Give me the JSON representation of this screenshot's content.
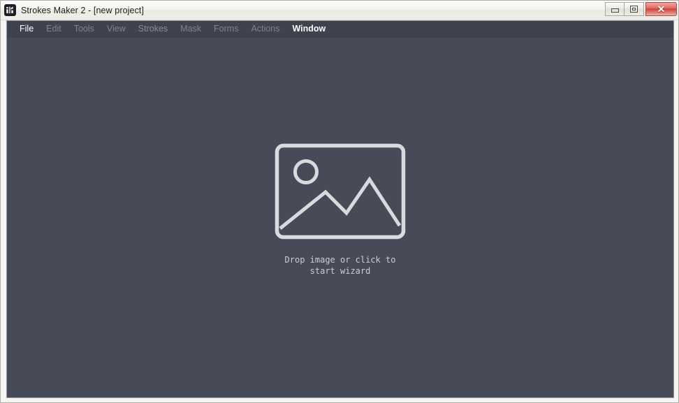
{
  "window": {
    "title": "Strokes Maker 2 - [new project]",
    "icon": "app-logo-icon",
    "controls": {
      "minimize_label": "–",
      "maximize_label": "□",
      "close_label": "✕"
    }
  },
  "menu": {
    "items": [
      {
        "label": "File",
        "state": "active"
      },
      {
        "label": "Edit",
        "state": "dim"
      },
      {
        "label": "Tools",
        "state": "dim"
      },
      {
        "label": "View",
        "state": "dim"
      },
      {
        "label": "Strokes",
        "state": "semi"
      },
      {
        "label": "Mask",
        "state": "dim"
      },
      {
        "label": "Forms",
        "state": "dim"
      },
      {
        "label": "Actions",
        "state": "dim"
      },
      {
        "label": "Window",
        "state": "bold"
      }
    ]
  },
  "canvas": {
    "placeholder_icon": "image-placeholder-icon",
    "drop_hint": "Drop image or click to\nstart wizard"
  },
  "colors": {
    "client_background": "#474b58",
    "menu_background": "#3f434f",
    "titlebar_text": "#1c1c1c",
    "menu_active_text": "#ffffff",
    "menu_dim_text": "#7e838f",
    "hint_text": "#c9cdd6",
    "placeholder_stroke": "#d8dade",
    "close_button": "#cf4236"
  }
}
